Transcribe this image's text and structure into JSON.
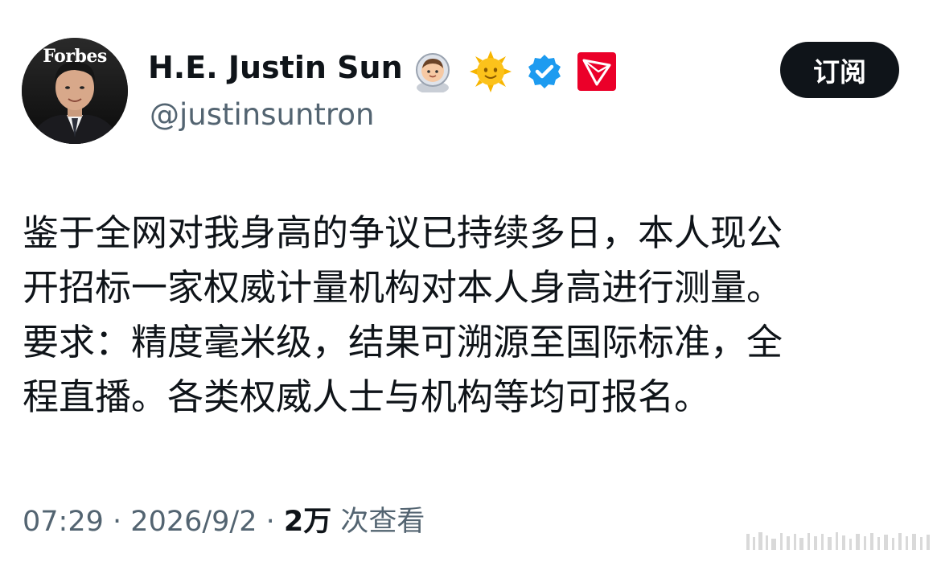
{
  "author": {
    "name": "H.E. Justin Sun",
    "handle": "@justinsuntron",
    "avatar_caption": "Forbes",
    "badges": [
      "astronaut-emoji",
      "sun-emoji",
      "verified-badge",
      "tron-logo"
    ]
  },
  "subscribe_label": "订阅",
  "tweet": {
    "lines": [
      "鉴于全网对我身高的争议已持续多日，本人现公",
      "开招标一家权威计量机构对本人身高进行测量。",
      "要求：精度毫米级，结果可溯源至国际标准，全",
      "程直播。各类权威人士与机构等均可报名。"
    ]
  },
  "meta": {
    "time": "07:29",
    "separator": "·",
    "date": "2026/9/2",
    "views_count": "2万",
    "views_label": "次查看"
  },
  "colors": {
    "text": "#0f1419",
    "secondary": "#536471",
    "verified": "#1d9bf0",
    "tron": "#eb0029",
    "button": "#0f1419"
  }
}
